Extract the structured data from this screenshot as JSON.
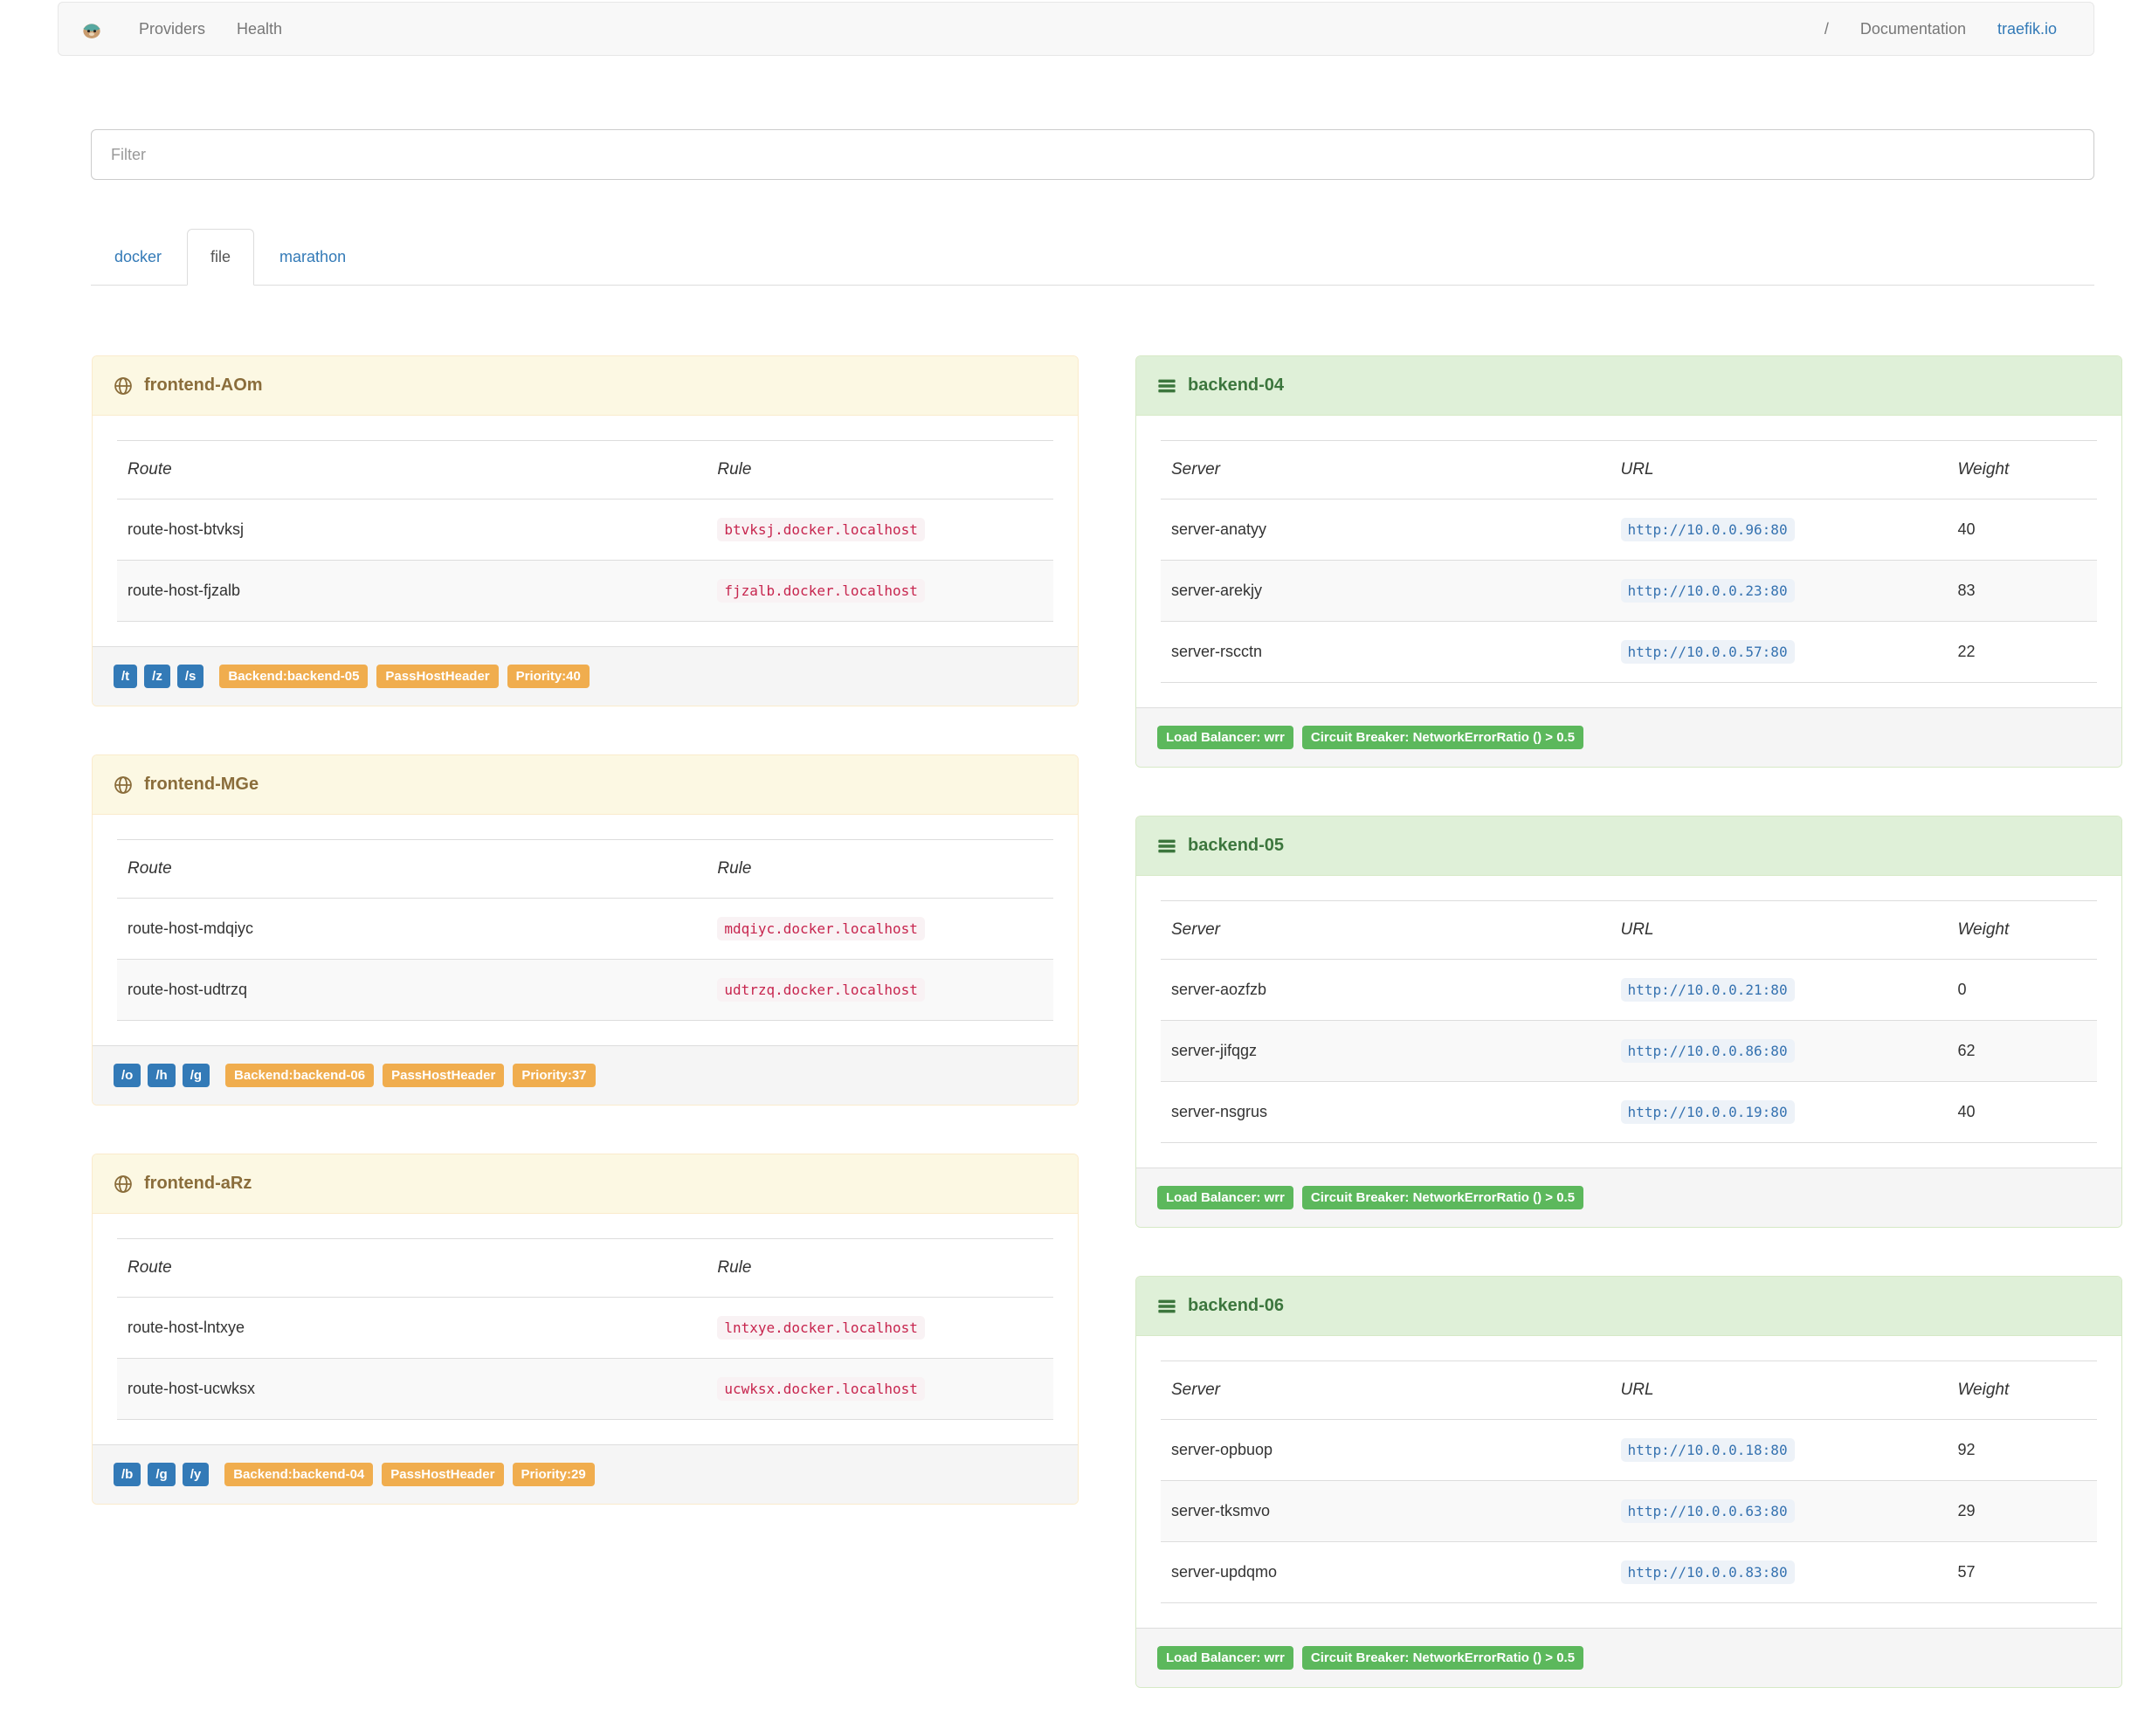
{
  "navbar": {
    "providers": "Providers",
    "health": "Health",
    "slash": "/",
    "documentation": "Documentation",
    "site": "traefik.io"
  },
  "filter": {
    "placeholder": "Filter"
  },
  "tabs": {
    "docker": "docker",
    "file": "file",
    "marathon": "marathon",
    "active_tab": "file"
  },
  "theme": {
    "primary_blue": "#337ab7",
    "warning_orange": "#f0ad4e",
    "success_green": "#5cb85c",
    "frontend_header_bg": "#fcf8e3",
    "frontend_header_text": "#8a6d3b",
    "backend_header_bg": "#dff0d8",
    "backend_header_text": "#3c763d",
    "rule_code_color": "#c7254e",
    "url_code_color": "#3572b0"
  },
  "icons": {
    "brand": "traefik-logo",
    "frontend": "globe-icon",
    "backend": "tasks-icon"
  },
  "frontends": [
    {
      "title": "frontend-AOm",
      "col_route": "Route",
      "col_rule": "Rule",
      "routes": [
        {
          "name": "route-host-btvksj",
          "rule": "btvksj.docker.localhost"
        },
        {
          "name": "route-host-fjzalb",
          "rule": "fjzalb.docker.localhost"
        }
      ],
      "entrypoints": [
        "/t",
        "/z",
        "/s"
      ],
      "backend_badge": "Backend:backend-05",
      "passhost_badge": "PassHostHeader",
      "priority_badge": "Priority:40"
    },
    {
      "title": "frontend-MGe",
      "col_route": "Route",
      "col_rule": "Rule",
      "routes": [
        {
          "name": "route-host-mdqiyc",
          "rule": "mdqiyc.docker.localhost"
        },
        {
          "name": "route-host-udtrzq",
          "rule": "udtrzq.docker.localhost"
        }
      ],
      "entrypoints": [
        "/o",
        "/h",
        "/g"
      ],
      "backend_badge": "Backend:backend-06",
      "passhost_badge": "PassHostHeader",
      "priority_badge": "Priority:37"
    },
    {
      "title": "frontend-aRz",
      "col_route": "Route",
      "col_rule": "Rule",
      "routes": [
        {
          "name": "route-host-lntxye",
          "rule": "lntxye.docker.localhost"
        },
        {
          "name": "route-host-ucwksx",
          "rule": "ucwksx.docker.localhost"
        }
      ],
      "entrypoints": [
        "/b",
        "/g",
        "/y"
      ],
      "backend_badge": "Backend:backend-04",
      "passhost_badge": "PassHostHeader",
      "priority_badge": "Priority:29"
    }
  ],
  "backends": [
    {
      "title": "backend-04",
      "col_server": "Server",
      "col_url": "URL",
      "col_weight": "Weight",
      "servers": [
        {
          "name": "server-anatyy",
          "url": "http://10.0.0.96:80",
          "weight": "40"
        },
        {
          "name": "server-arekjy",
          "url": "http://10.0.0.23:80",
          "weight": "83"
        },
        {
          "name": "server-rscctn",
          "url": "http://10.0.0.57:80",
          "weight": "22"
        }
      ],
      "lb_badge": "Load Balancer: wrr",
      "cb_badge": "Circuit Breaker: NetworkErrorRatio () > 0.5"
    },
    {
      "title": "backend-05",
      "col_server": "Server",
      "col_url": "URL",
      "col_weight": "Weight",
      "servers": [
        {
          "name": "server-aozfzb",
          "url": "http://10.0.0.21:80",
          "weight": "0"
        },
        {
          "name": "server-jifqgz",
          "url": "http://10.0.0.86:80",
          "weight": "62"
        },
        {
          "name": "server-nsgrus",
          "url": "http://10.0.0.19:80",
          "weight": "40"
        }
      ],
      "lb_badge": "Load Balancer: wrr",
      "cb_badge": "Circuit Breaker: NetworkErrorRatio () > 0.5"
    },
    {
      "title": "backend-06",
      "col_server": "Server",
      "col_url": "URL",
      "col_weight": "Weight",
      "servers": [
        {
          "name": "server-opbuop",
          "url": "http://10.0.0.18:80",
          "weight": "92"
        },
        {
          "name": "server-tksmvo",
          "url": "http://10.0.0.63:80",
          "weight": "29"
        },
        {
          "name": "server-updqmo",
          "url": "http://10.0.0.83:80",
          "weight": "57"
        }
      ],
      "lb_badge": "Load Balancer: wrr",
      "cb_badge": "Circuit Breaker: NetworkErrorRatio () > 0.5"
    }
  ]
}
